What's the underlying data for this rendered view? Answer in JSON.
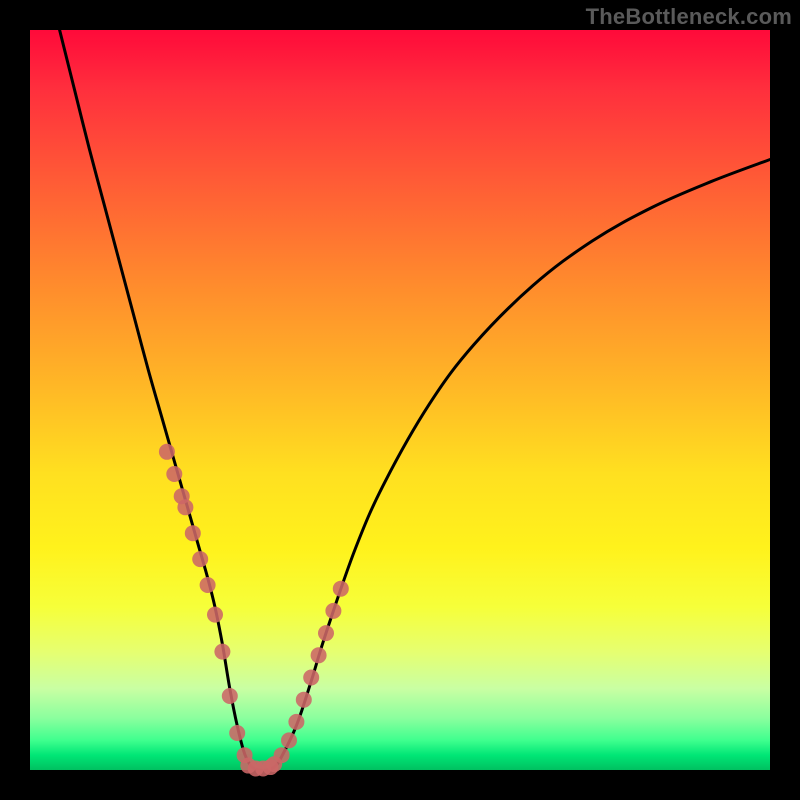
{
  "watermark": "TheBottleneck.com",
  "chart_data": {
    "type": "line",
    "title": "",
    "xlabel": "",
    "ylabel": "",
    "xlim": [
      0,
      100
    ],
    "ylim": [
      0,
      100
    ],
    "grid": false,
    "legend": false,
    "background_gradient": {
      "top": "#ff0a3a",
      "bottom": "#00c060",
      "meaning": "bottleneck severity (red high, green low)"
    },
    "series": [
      {
        "name": "bottleneck-curve",
        "color": "#000000",
        "x": [
          4,
          6,
          8,
          10,
          12,
          14,
          16,
          18,
          20,
          22,
          23,
          24,
          25,
          26,
          27,
          28,
          29,
          30,
          31,
          32,
          33,
          34,
          36,
          38,
          40,
          44,
          48,
          54,
          60,
          68,
          76,
          84,
          92,
          100
        ],
        "values": [
          100,
          92,
          84,
          76.5,
          69,
          61.5,
          54,
          47,
          40,
          33,
          29.5,
          26,
          22,
          17,
          11,
          6,
          2.2,
          0.4,
          0,
          0,
          0.4,
          1.8,
          6,
          12,
          18.5,
          30,
          39,
          49.5,
          57.5,
          65.5,
          71.5,
          76,
          79.5,
          82.5
        ]
      },
      {
        "name": "left-branch-markers",
        "type": "scatter",
        "color": "#cc6666",
        "x": [
          18.5,
          19.5,
          20.5,
          21.0,
          22.0,
          23.0,
          24.0,
          25.0,
          26.0,
          27.0,
          28.0,
          29.0
        ],
        "values": [
          43.0,
          40.0,
          37.0,
          35.5,
          32.0,
          28.5,
          25.0,
          21.0,
          16.0,
          10.0,
          5.0,
          2.0
        ]
      },
      {
        "name": "right-branch-markers",
        "type": "scatter",
        "color": "#cc6666",
        "x": [
          34.0,
          35.0,
          36.0,
          37.0,
          38.0,
          39.0,
          40.0,
          41.0,
          42.0
        ],
        "values": [
          2.0,
          4.0,
          6.5,
          9.5,
          12.5,
          15.5,
          18.5,
          21.5,
          24.5
        ]
      },
      {
        "name": "bottom-markers",
        "type": "scatter",
        "color": "#cc6666",
        "x": [
          29.5,
          30.5,
          31.5,
          32.5,
          33.0
        ],
        "values": [
          0.6,
          0.2,
          0.2,
          0.4,
          0.8
        ]
      }
    ]
  }
}
